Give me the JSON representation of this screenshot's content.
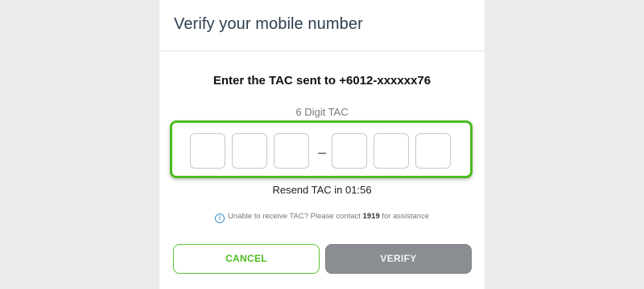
{
  "dialog": {
    "title": "Verify your mobile number"
  },
  "tac": {
    "instruction": "Enter the TAC sent to +6012-xxxxxx76",
    "field_label": "6 Digit TAC",
    "digits": [
      "",
      "",
      "",
      "",
      "",
      ""
    ],
    "resend_text": "Resend TAC in 01:56"
  },
  "help": {
    "text_before": "Unable to receive TAC? Please contact ",
    "contact_number": "1919",
    "text_after": " for assistance",
    "icon": "info-icon"
  },
  "buttons": {
    "cancel_label": "CANCEL",
    "verify_label": "VERIFY"
  },
  "colors": {
    "accent_green": "#4cbb1f",
    "verify_disabled": "#8a8d91",
    "title_color": "#2d3e50"
  }
}
